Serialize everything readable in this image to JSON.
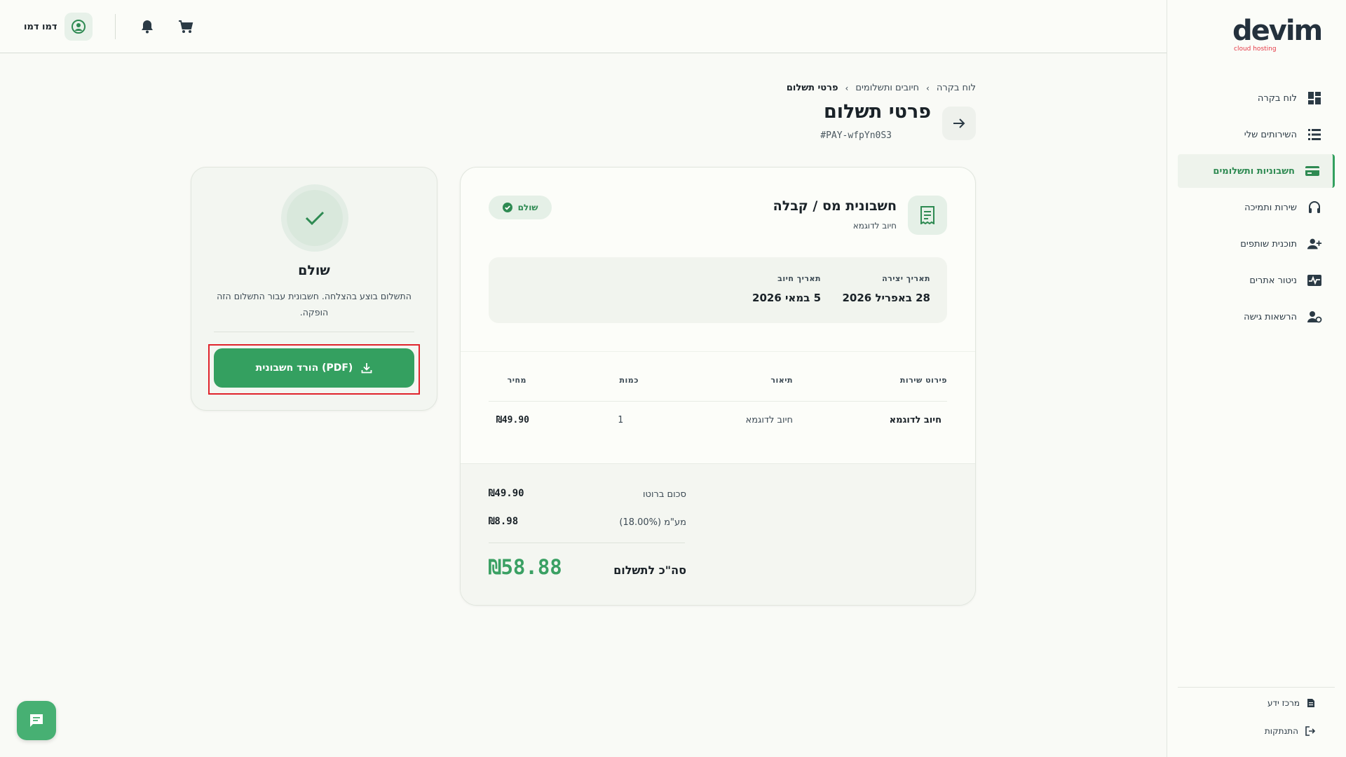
{
  "brand": {
    "name": "devim",
    "tagline": "cloud hosting"
  },
  "sidebar": {
    "items": [
      {
        "label": "לוח בקרה",
        "icon": "dashboard-icon"
      },
      {
        "label": "השירותים שלי",
        "icon": "list-icon"
      },
      {
        "label": "חשבוניות ותשלומים",
        "icon": "credit-card-icon",
        "active": true
      },
      {
        "label": "שירות ותמיכה",
        "icon": "headset-icon"
      },
      {
        "label": "תוכנית שותפים",
        "icon": "add-user-icon"
      },
      {
        "label": "ניטור אתרים",
        "icon": "pulse-icon"
      },
      {
        "label": "הרשאות גישה",
        "icon": "user-settings-icon"
      }
    ],
    "footer": [
      {
        "label": "מרכז ידע",
        "icon": "document-icon"
      },
      {
        "label": "התנתקות",
        "icon": "logout-icon"
      }
    ]
  },
  "topbar": {
    "user_name": "דמו דמו"
  },
  "breadcrumb": {
    "home": "לוח בקרה",
    "section": "חיובים ותשלומים",
    "current": "פרטי תשלום"
  },
  "page": {
    "title": "פרטי תשלום",
    "payment_id": "#PAY-wfpYn0S3"
  },
  "invoice": {
    "title": "חשבונית מס / קבלה",
    "subtitle": "חיוב לדוגמא",
    "status": "שולם",
    "created_label": "תאריך יצירה",
    "created_value": "28 באפריל 2026",
    "due_label": "תאריך חיוב",
    "due_value": "5 במאי 2026",
    "table": {
      "headers": {
        "service": "פירוט שירות",
        "description": "תיאור",
        "quantity": "כמות",
        "price": "מחיר"
      },
      "rows": [
        {
          "service": "חיוב לדוגמא",
          "description": "חיוב לדוגמא",
          "quantity": "1",
          "price": "₪49.90"
        }
      ]
    },
    "totals": {
      "subtotal_label": "סכום ברוטו",
      "subtotal_value": "₪49.90",
      "vat_label": "מע\"מ (18.00%)",
      "vat_value": "₪8.98",
      "grand_label": "סה\"כ לתשלום",
      "grand_value": "₪58.88"
    }
  },
  "payment_card": {
    "status": "שולם",
    "message": "התשלום בוצע בהצלחה. חשבונית עבור התשלום הזה הופקה.",
    "download_label": "הורד חשבונית (PDF)"
  },
  "colors": {
    "accent": "#34a060",
    "highlight": "#e0242c",
    "text": "#1a2228"
  }
}
